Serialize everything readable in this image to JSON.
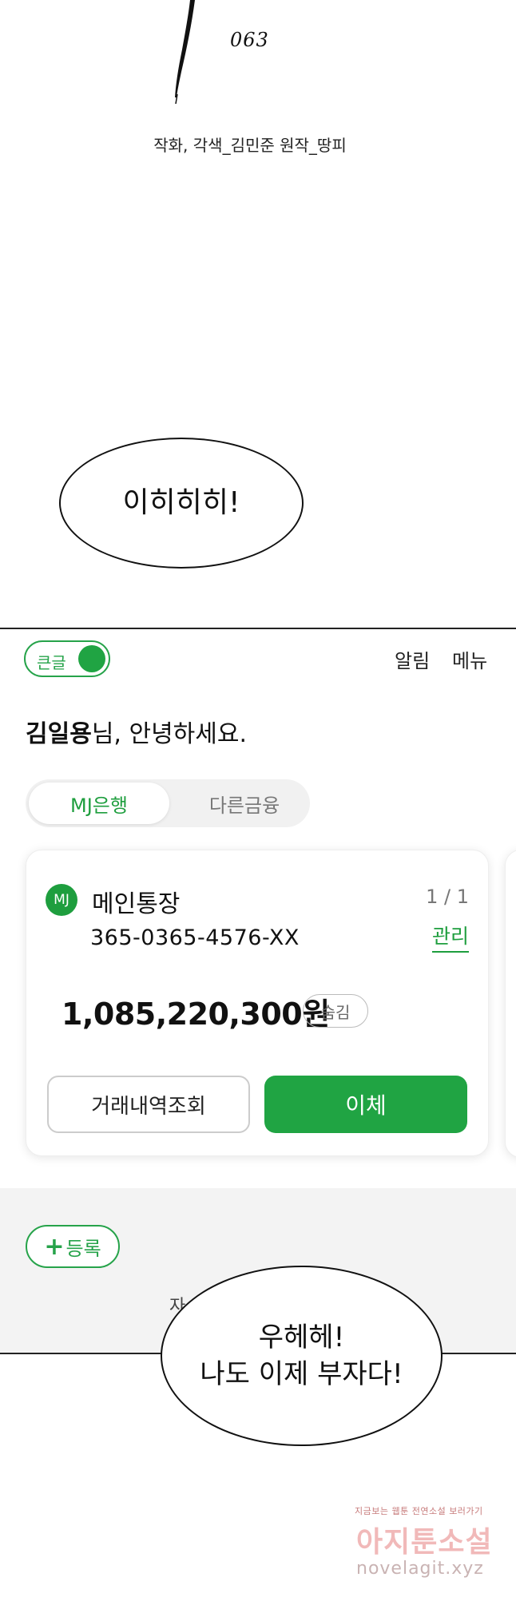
{
  "comic": {
    "episode_number": "063",
    "credits": "작화, 각색_김민준  원작_땅피",
    "bubble_top": "이히히히!",
    "bubble_bottom_line1": "우헤헤!",
    "bubble_bottom_line2": "나도 이제 부자다!"
  },
  "phone": {
    "toggle_label": "큰글",
    "nav_alert": "알림",
    "nav_menu": "메뉴",
    "greeting_name": "김일용",
    "greeting_rest": "님, 안녕하세요.",
    "tabs": [
      "MJ은행",
      "다른금융"
    ],
    "account": {
      "badge": "MJ",
      "name": "메인통장",
      "number": "365-0365-4576-XX",
      "page": "1 / 1",
      "manage_label": "관리",
      "balance": "1,085,220,300원",
      "hide_label": "숨김",
      "history_button": "거래내역조회",
      "transfer_button": "이체"
    },
    "register_button": "등록",
    "cutoff_text": "자"
  },
  "watermark": {
    "tagline": "지금보는 웹툰 전연소설 보러가기",
    "brand": "아지툰소설",
    "url": "novelagit.xyz"
  },
  "colors": {
    "accent_green": "#20a443",
    "card_bg": "#ffffff",
    "gray_area": "#f3f3f3"
  }
}
